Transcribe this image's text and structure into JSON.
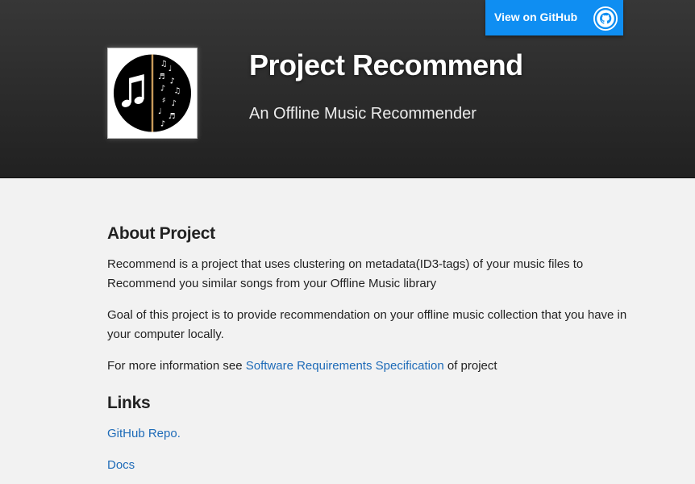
{
  "header": {
    "title": "Project Recommend",
    "subtitle": "An Offline Music Recommender",
    "github_button_label": "View on GitHub",
    "github_icon": "github-icon",
    "logo_icon": "music-notes-logo-icon"
  },
  "about": {
    "heading": "About Project",
    "paragraph1": "Recommend is a project that uses clustering on metadata(ID3-tags) of your music files to Recommend you similar songs from your Offline Music library",
    "paragraph2": "Goal of this project is to provide recommendation on your offline music collection that you have in your computer locally.",
    "more_info_prefix": "For more information see ",
    "srs_link": "Software Requirements Specification",
    "more_info_suffix": " of project"
  },
  "links": {
    "heading": "Links",
    "items": [
      "GitHub Repo.",
      "Docs"
    ]
  },
  "colors": {
    "header_bg": "#2b2b2b",
    "button_bg": "#0f8ef2",
    "link": "#1e6bb8",
    "page_bg": "#f2f2f2"
  }
}
